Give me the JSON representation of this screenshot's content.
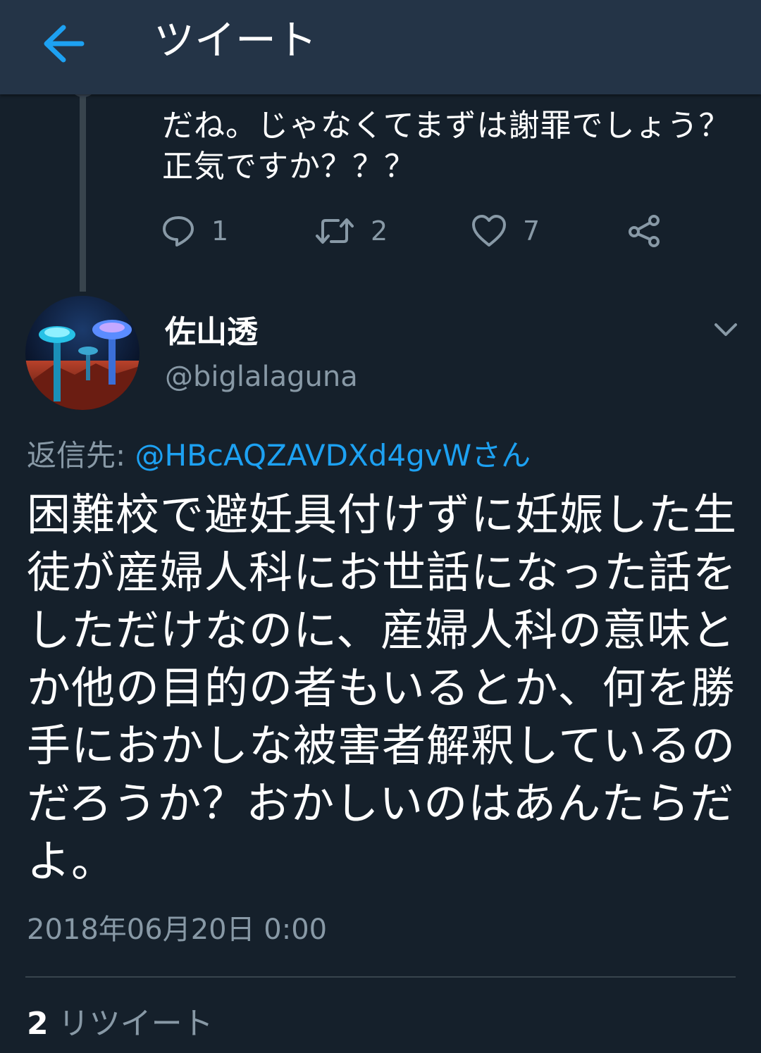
{
  "header": {
    "title": "ツイート"
  },
  "previous_tweet": {
    "text": "だね。じゃなくてまずは謝罪でしょう？正気ですか？？？",
    "reply_count": "1",
    "retweet_count": "2",
    "like_count": "7"
  },
  "tweet": {
    "display_name": "佐山透",
    "handle": "@biglalaguna",
    "reply_to_label": "返信先:",
    "reply_to_mention": "@HBcAQZAVDXd4gvWさん",
    "text": "困難校で避妊具付けずに妊娠した生徒が産婦人科にお世話になった話をしただけなのに、産婦人科の意味とか他の目的の者もいるとか、何を勝手におかしな被害者解釈しているのだろうか？おかしいのはあんたらだよ。",
    "timestamp": "2018年06月20日 0:00",
    "retweet_count": "2",
    "retweet_label": "リツイート"
  },
  "colors": {
    "background": "#15202b",
    "header": "#243447",
    "accent": "#1da1f2",
    "secondary_text": "#8899a6",
    "divider": "#38444d"
  }
}
